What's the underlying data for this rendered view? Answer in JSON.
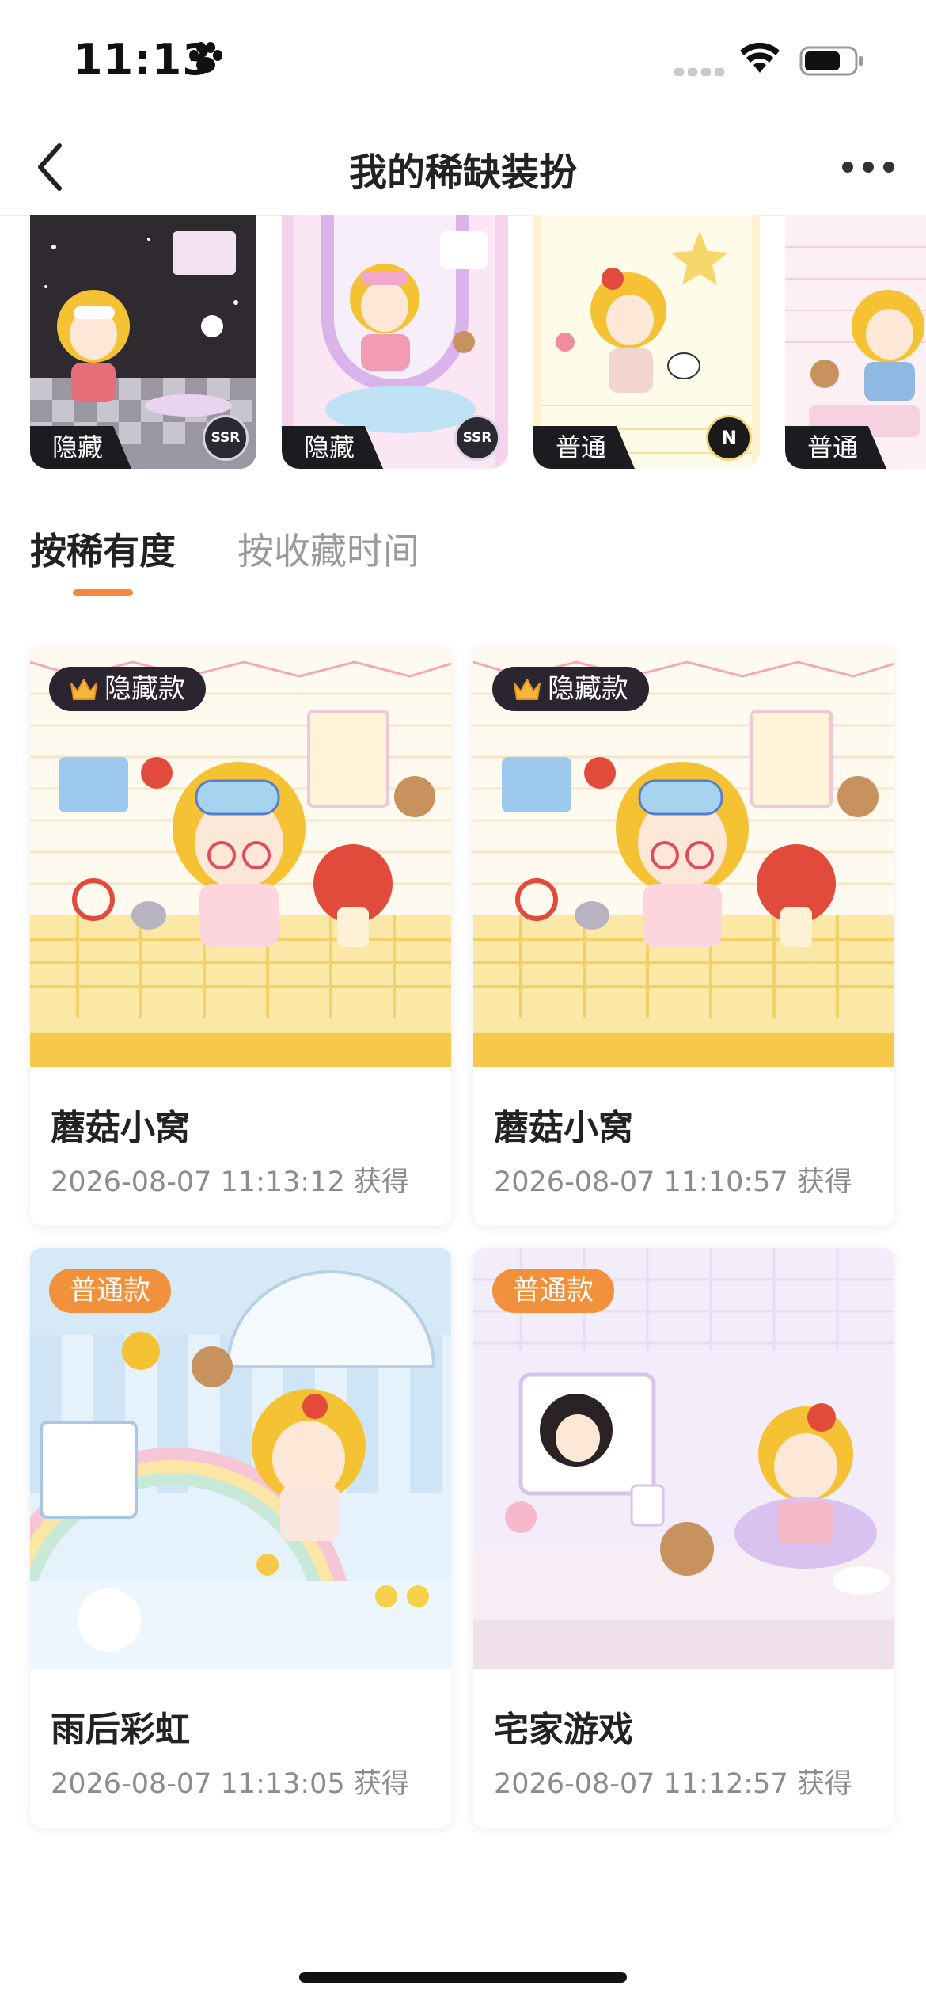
{
  "status_bar": {
    "time": "11:13"
  },
  "nav": {
    "title": "我的稀缺装扮"
  },
  "carousel": [
    {
      "tag": "隐藏",
      "grade": "SSR"
    },
    {
      "tag": "隐藏",
      "grade": "SSR"
    },
    {
      "tag": "普通",
      "grade": "N"
    },
    {
      "tag": "普通",
      "grade": ""
    }
  ],
  "tabs": [
    {
      "label": "按稀有度",
      "active": true
    },
    {
      "label": "按收藏时间",
      "active": false
    }
  ],
  "cards": [
    {
      "badge": "隐藏款",
      "name": "蘑菇小窝",
      "time": "2026-08-07 11:13:12 获得"
    },
    {
      "badge": "隐藏款",
      "name": "蘑菇小窝",
      "time": "2026-08-07 11:10:57 获得"
    },
    {
      "badge": "普通款",
      "name": "雨后彩虹",
      "time": "2026-08-07 11:13:05 获得"
    },
    {
      "badge": "普通款",
      "name": "宅家游戏",
      "time": "2026-08-07 11:12:57 获得"
    }
  ],
  "colors": {
    "accent": "#f5893a",
    "hidden_badge": "#2b2530",
    "common_badge": "#f2913b"
  }
}
